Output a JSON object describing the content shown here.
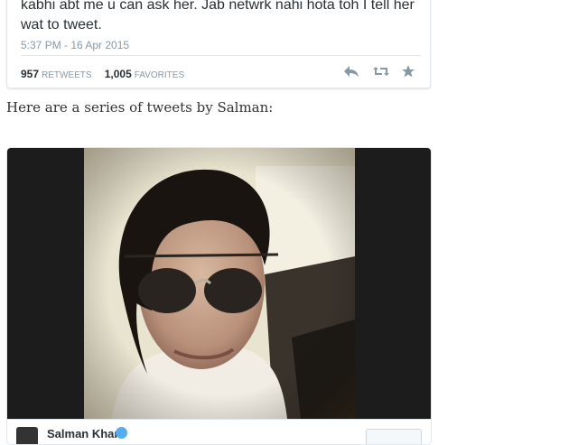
{
  "tweet": {
    "text": "kabhi abt me u can ask her. Jab netwrk nahi hota toh I tell her wat to tweet.",
    "time": "5:37 PM - 16 Apr 2015",
    "retweets_count": "957",
    "retweets_label": "RETWEETS",
    "favorites_count": "1,005",
    "favorites_label": "FAVORITES"
  },
  "intro_text": "Here are a series of tweets by Salman:",
  "embed": {
    "author_name": "Salman Khan"
  },
  "colors": {
    "icon_gray": "#8899a6",
    "verified_blue": "#55acee"
  },
  "icons": [
    "reply-icon",
    "retweet-icon",
    "favorite-icon",
    "verified-icon"
  ]
}
